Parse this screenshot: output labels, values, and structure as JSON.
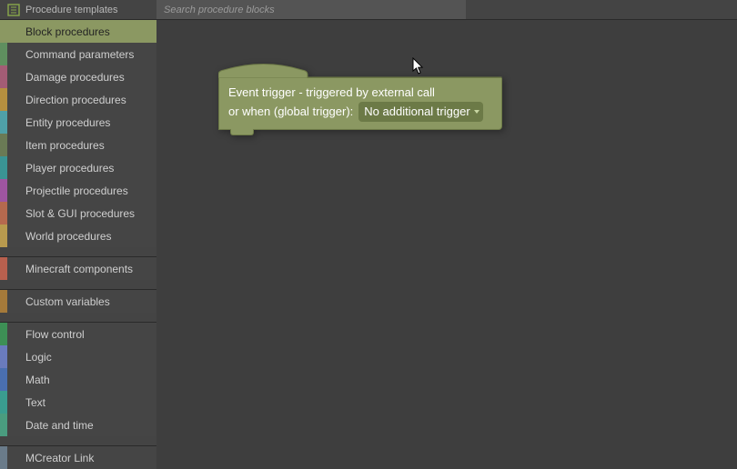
{
  "topbar": {
    "templates_label": "Procedure templates",
    "search_placeholder": "Search procedure blocks"
  },
  "sidebar": {
    "groups": [
      {
        "items": [
          {
            "label": "Block procedures",
            "color": "#8b9862",
            "selected": true
          },
          {
            "label": "Command parameters",
            "color": "#5f8f5f"
          },
          {
            "label": "Damage procedures",
            "color": "#a35c75"
          },
          {
            "label": "Direction procedures",
            "color": "#b58f3f"
          },
          {
            "label": "Entity procedures",
            "color": "#4fa0a8"
          },
          {
            "label": "Item procedures",
            "color": "#6a7a55"
          },
          {
            "label": "Player procedures",
            "color": "#3a9494"
          },
          {
            "label": "Projectile procedures",
            "color": "#9e55a0"
          },
          {
            "label": "Slot & GUI procedures",
            "color": "#b5694e"
          },
          {
            "label": "World procedures",
            "color": "#b89a4e"
          }
        ]
      },
      {
        "items": [
          {
            "label": "Minecraft components",
            "color": "#b8604e"
          }
        ]
      },
      {
        "items": [
          {
            "label": "Custom variables",
            "color": "#a57a3a"
          }
        ]
      },
      {
        "items": [
          {
            "label": "Flow control",
            "color": "#3d8f55"
          },
          {
            "label": "Logic",
            "color": "#6a7bbd"
          },
          {
            "label": "Math",
            "color": "#4a6fb0"
          },
          {
            "label": "Text",
            "color": "#3a9c8f"
          },
          {
            "label": "Date and time",
            "color": "#4a9c7f"
          }
        ]
      },
      {
        "items": [
          {
            "label": "MCreator Link",
            "color": "#6a7b8a"
          }
        ]
      }
    ]
  },
  "block": {
    "line1": "Event trigger - triggered by external call",
    "line2_prefix": "or when (global trigger):",
    "dropdown_value": "No additional trigger"
  }
}
